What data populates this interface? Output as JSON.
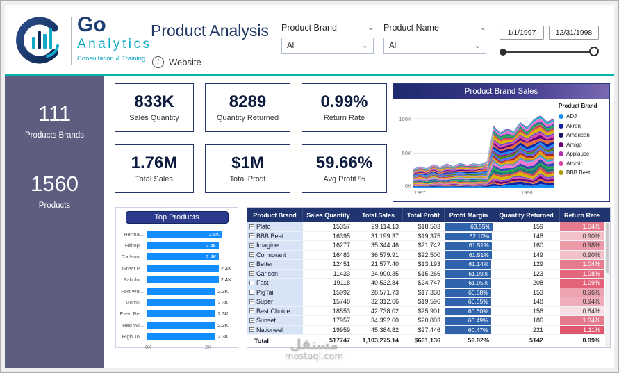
{
  "header": {
    "logo": {
      "go": "Go",
      "analytics": "Analytics",
      "tagline": "Consultation & Training"
    },
    "title": "Product Analysis",
    "website_label": "Website",
    "filters": {
      "product_brand_label": "Product Brand",
      "product_brand_value": "All",
      "product_name_label": "Product Name",
      "product_name_value": "All",
      "date_start": "1/1/1997",
      "date_end": "12/31/1998"
    }
  },
  "sidebar": {
    "brands_count": "111",
    "brands_label": "Products Brands",
    "products_count": "1560",
    "products_label": "Products"
  },
  "kpis": {
    "cards": [
      {
        "value": "833K",
        "label": "Sales Quantity"
      },
      {
        "value": "8289",
        "label": "Quantity Returned"
      },
      {
        "value": "0.99%",
        "label": "Return Rate"
      },
      {
        "value": "1.76M",
        "label": "Total Sales"
      },
      {
        "value": "$1M",
        "label": "Total Profit"
      },
      {
        "value": "59.66%",
        "label": "Avg Profit %"
      }
    ]
  },
  "chart_data": [
    {
      "type": "area",
      "stacked": true,
      "title": "Product Brand Sales",
      "legend_title": "Product Brand",
      "legend": [
        {
          "label": "ADJ",
          "color": "#118DFF"
        },
        {
          "label": "Akron",
          "color": "#12239E"
        },
        {
          "label": "American",
          "color": "#1B1464"
        },
        {
          "label": "Amigo",
          "color": "#6B007B"
        },
        {
          "label": "Applause",
          "color": "#B232B2"
        },
        {
          "label": "Atomic",
          "color": "#E044A7"
        },
        {
          "label": "BBB Best",
          "color": "#B09B00"
        }
      ],
      "x_ticks": [
        "1997",
        "1998"
      ],
      "y_ticks": [
        "0K",
        "50K",
        "100K"
      ],
      "y_max_k": 115,
      "total_envelope_k": [
        27,
        31,
        28,
        34,
        30,
        35,
        31,
        36,
        33,
        35,
        34,
        38,
        90,
        80,
        86,
        82,
        95,
        88,
        99,
        105,
        96,
        100
      ],
      "band_count": 34,
      "band_palette": [
        "#118DFF",
        "#12239E",
        "#E66C37",
        "#6B007B",
        "#E044A7",
        "#744EC2",
        "#D9B300",
        "#D64550",
        "#197278",
        "#1AAB40",
        "#3049AD",
        "#F472D0",
        "#00B7C3",
        "#8764B8",
        "#C4A200",
        "#FF8C00",
        "#A4262C",
        "#4F6BED",
        "#498205",
        "#881798"
      ],
      "note": "Stacked area of monthly sales quantity across all product brands; totals estimated from gridlines (0K-100K), step up occurs near start of 1998"
    },
    {
      "type": "bar",
      "orientation": "horizontal",
      "title": "Top Products",
      "categories": [
        "Herma...",
        "Hilltop...",
        "Carlson...",
        "Great P...",
        "Fabulo...",
        "Fort We...",
        "Moms...",
        "Even Be...",
        "Red Wi...",
        "High To..."
      ],
      "values_k": [
        2.5,
        2.4,
        2.4,
        2.4,
        2.4,
        2.3,
        2.3,
        2.3,
        2.3,
        2.3
      ],
      "labels": [
        "2.5K",
        "2.4K",
        "2.4K",
        "2.4K",
        "2.4K",
        "2.3K",
        "2.3K",
        "2.3K",
        "2.3K",
        "2.3K"
      ],
      "label_inside": [
        true,
        true,
        true,
        false,
        false,
        false,
        false,
        false,
        false,
        false
      ],
      "x_ticks": [
        "0K",
        "2K"
      ],
      "x_max_k": 2.5,
      "bar_color": "#118DFF"
    },
    {
      "type": "table",
      "columns": [
        "Product Brand",
        "Sales Quantity",
        "Total Sales",
        "Total Profit",
        "Profit Margin",
        "Quantity Returned",
        "Return Rate"
      ],
      "collapse_glyph": "−",
      "profit_bar_color": "#2F64AD",
      "return_rate_scale": {
        "min": 0.84,
        "max": 1.11,
        "light": "#F8DFE4",
        "dark": "#E05870"
      },
      "rows": [
        {
          "brand": "Plato",
          "sales_quantity": "15357",
          "total_sales": "29,114.13",
          "total_profit": "$18,503",
          "profit_margin": "63.55%",
          "profit_margin_value": 63.55,
          "quantity_returned": "159",
          "return_rate": "1.04%",
          "return_rate_value": 1.04
        },
        {
          "brand": "BBB Best",
          "sales_quantity": "16395",
          "total_sales": "31,199.37",
          "total_profit": "$19,375",
          "profit_margin": "62.10%",
          "profit_margin_value": 62.1,
          "quantity_returned": "148",
          "return_rate": "0.90%",
          "return_rate_value": 0.9
        },
        {
          "brand": "Imagine",
          "sales_quantity": "16277",
          "total_sales": "35,344.46",
          "total_profit": "$21,742",
          "profit_margin": "61.51%",
          "profit_margin_value": 61.51,
          "quantity_returned": "160",
          "return_rate": "0.98%",
          "return_rate_value": 0.98
        },
        {
          "brand": "Cormorant",
          "sales_quantity": "16483",
          "total_sales": "36,579.91",
          "total_profit": "$22,500",
          "profit_margin": "61.51%",
          "profit_margin_value": 61.51,
          "quantity_returned": "149",
          "return_rate": "0.90%",
          "return_rate_value": 0.9
        },
        {
          "brand": "Better",
          "sales_quantity": "12451",
          "total_sales": "21,577.40",
          "total_profit": "$13,193",
          "profit_margin": "61.14%",
          "profit_margin_value": 61.14,
          "quantity_returned": "129",
          "return_rate": "1.04%",
          "return_rate_value": 1.04
        },
        {
          "brand": "Carlson",
          "sales_quantity": "11433",
          "total_sales": "24,990.35",
          "total_profit": "$15,266",
          "profit_margin": "61.09%",
          "profit_margin_value": 61.09,
          "quantity_returned": "123",
          "return_rate": "1.08%",
          "return_rate_value": 1.08
        },
        {
          "brand": "Fast",
          "sales_quantity": "19118",
          "total_sales": "40,532.84",
          "total_profit": "$24,747",
          "profit_margin": "61.05%",
          "profit_margin_value": 61.05,
          "quantity_returned": "208",
          "return_rate": "1.09%",
          "return_rate_value": 1.09
        },
        {
          "brand": "PigTail",
          "sales_quantity": "15992",
          "total_sales": "28,571.73",
          "total_profit": "$17,338",
          "profit_margin": "60.68%",
          "profit_margin_value": 60.68,
          "quantity_returned": "153",
          "return_rate": "0.96%",
          "return_rate_value": 0.96
        },
        {
          "brand": "Super",
          "sales_quantity": "15748",
          "total_sales": "32,312.66",
          "total_profit": "$19,596",
          "profit_margin": "60.65%",
          "profit_margin_value": 60.65,
          "quantity_returned": "148",
          "return_rate": "0.94%",
          "return_rate_value": 0.94
        },
        {
          "brand": "Best Choice",
          "sales_quantity": "18553",
          "total_sales": "42,738.02",
          "total_profit": "$25,901",
          "profit_margin": "60.60%",
          "profit_margin_value": 60.6,
          "quantity_returned": "156",
          "return_rate": "0.84%",
          "return_rate_value": 0.84
        },
        {
          "brand": "Sunset",
          "sales_quantity": "17957",
          "total_sales": "34,392.60",
          "total_profit": "$20,803",
          "profit_margin": "60.49%",
          "profit_margin_value": 60.49,
          "quantity_returned": "186",
          "return_rate": "1.04%",
          "return_rate_value": 1.04
        },
        {
          "brand": "Nationeel",
          "sales_quantity": "19959",
          "total_sales": "45,384.82",
          "total_profit": "$27,446",
          "profit_margin": "60.47%",
          "profit_margin_value": 60.47,
          "quantity_returned": "221",
          "return_rate": "1.11%",
          "return_rate_value": 1.11
        }
      ],
      "total_row": {
        "brand": "Total",
        "sales_quantity": "517747",
        "total_sales": "1,103,275.14",
        "total_profit": "$661,136",
        "profit_margin": "59.92%",
        "quantity_returned": "5142",
        "return_rate": "0.99%"
      }
    }
  ],
  "watermark": {
    "arabic": "مستقل",
    "domain": "mostaql.com"
  }
}
